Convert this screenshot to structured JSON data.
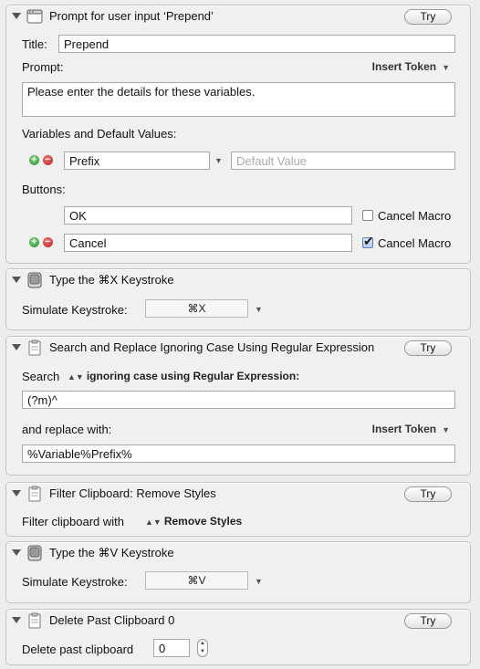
{
  "actions": {
    "prompt": {
      "title": "Prompt for user input ‘Prepend’",
      "try_label": "Try",
      "title_label": "Title:",
      "title_value": "Prepend",
      "prompt_label": "Prompt:",
      "insert_token_label": "Insert Token",
      "prompt_value": "Please enter the details for these variables.",
      "vars_label": "Variables and Default Values:",
      "var_name": "Prefix",
      "var_default_placeholder": "Default Value",
      "buttons_label": "Buttons:",
      "button1": "OK",
      "button2": "Cancel",
      "cancel_macro_label": "Cancel Macro",
      "button1_cancel_macro": false,
      "button2_cancel_macro": true
    },
    "type_x": {
      "title": "Type the ⌘X Keystroke",
      "simulate_label": "Simulate Keystroke:",
      "keystroke": "⌘X"
    },
    "search_replace": {
      "title": "Search and Replace Ignoring Case Using Regular Expression",
      "try_label": "Try",
      "search_label": "Search",
      "mode_value": "ignoring case using Regular Expression:",
      "search_value": "(?m)^",
      "replace_label": "and replace with:",
      "insert_token_label": "Insert Token",
      "replace_value": "%Variable%Prefix%"
    },
    "filter": {
      "title": "Filter Clipboard: Remove Styles",
      "try_label": "Try",
      "filter_label": "Filter clipboard with",
      "filter_value": "Remove Styles"
    },
    "type_v": {
      "title": "Type the ⌘V Keystroke",
      "simulate_label": "Simulate Keystroke:",
      "keystroke": "⌘V"
    },
    "delete_clip": {
      "title": "Delete Past Clipboard 0",
      "try_label": "Try",
      "delete_label": "Delete past clipboard",
      "delete_value": "0"
    }
  },
  "icons": {
    "prompt": "window-icon",
    "type_keystroke": "keyboard-icon",
    "clipboard": "clipboard-icon",
    "add": "add-circle-icon",
    "remove": "remove-circle-icon"
  },
  "colors": {
    "panel_bg": "#f0f0f0",
    "add_green": "#2f8f2f",
    "remove_red": "#b82020"
  }
}
